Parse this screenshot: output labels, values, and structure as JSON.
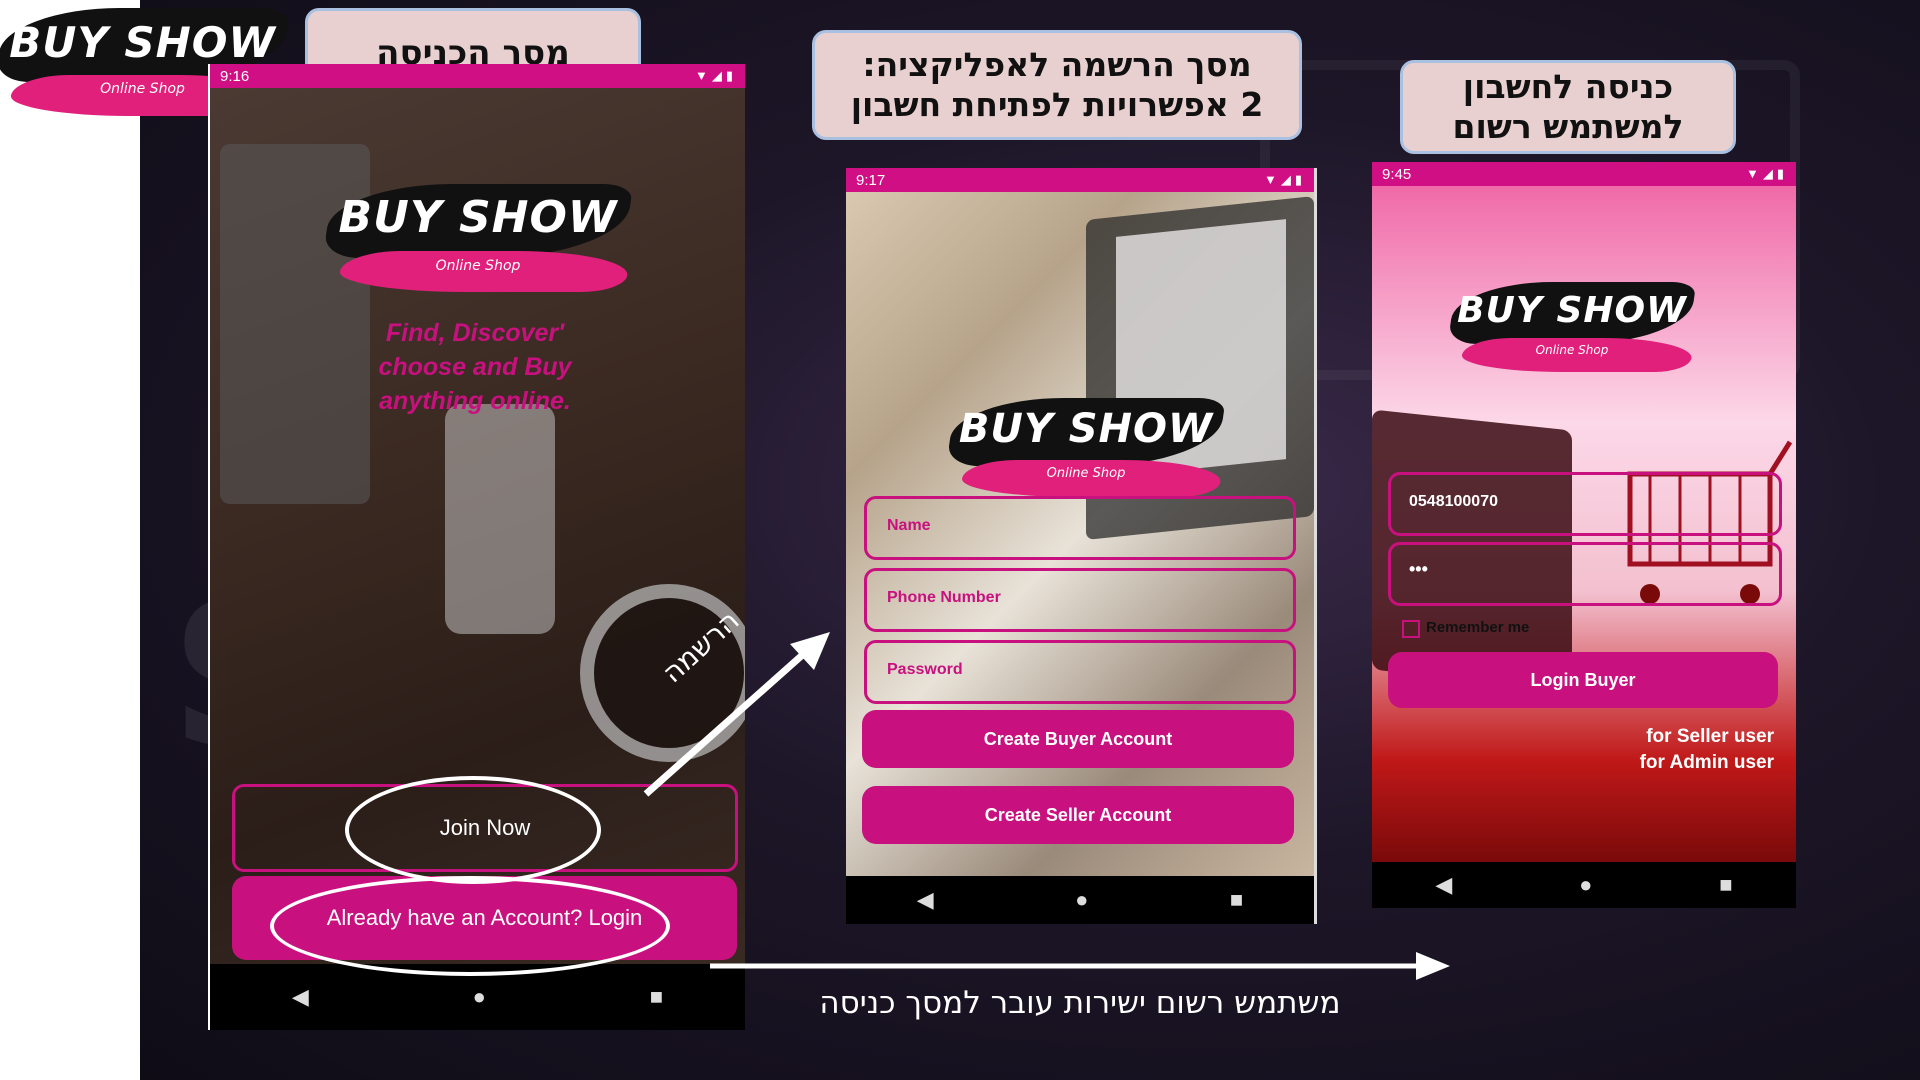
{
  "corner_logo": {
    "title": "BUY SHOW",
    "subtitle": "Online Shop"
  },
  "captions": {
    "entry_screen": "מסך הכניסה",
    "register_line1": "מסך הרשמה לאפליקציה:",
    "register_line2": "2 אפשרויות לפתיחת חשבון",
    "login_line1": "כניסה לחשבון",
    "login_line2": "למשתמש רשום"
  },
  "arrow_labels": {
    "register_arrow": "הרשמה",
    "bottom_note": "משתמש רשום ישירות עובר למסך כניסה"
  },
  "phone1": {
    "time": "9:16",
    "logo_title": "BUY SHOW",
    "logo_subtitle": "Online Shop",
    "tagline": "Find, Discover' choose and Buy anything online.",
    "join_button": "Join Now",
    "login_button": "Already have an Account? Login"
  },
  "phone2": {
    "time": "9:17",
    "logo_title": "BUY SHOW",
    "logo_subtitle": "Online Shop",
    "name_placeholder": "Name",
    "phone_placeholder": "Phone Number",
    "password_placeholder": "Password",
    "buyer_button": "Create Buyer Account",
    "seller_button": "Create Seller Account"
  },
  "phone3": {
    "time": "9:45",
    "logo_title": "BUY SHOW",
    "logo_subtitle": "Online Shop",
    "phone_value": "0548100070",
    "password_value": "•••",
    "remember_label": "Remember me",
    "login_button": "Login Buyer",
    "seller_link": "for Seller user",
    "admin_link": "for Admin user"
  },
  "colors": {
    "accent": "#c8117f",
    "status_bar": "#d10f85",
    "caption_bg": "#e9d0d0"
  },
  "nav_icons": [
    "back-icon",
    "home-icon",
    "recents-icon"
  ]
}
